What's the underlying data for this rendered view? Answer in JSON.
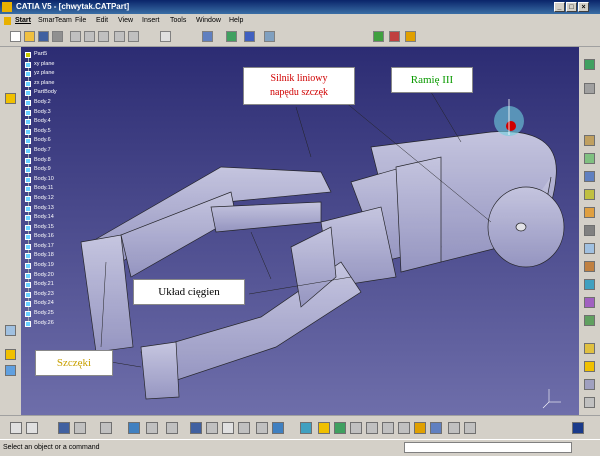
{
  "window": {
    "title": "CATIA V5 - [chwytak.CATPart]"
  },
  "menu": {
    "items": [
      "Start",
      "SmarTeam",
      "File",
      "Edit",
      "View",
      "Insert",
      "Tools",
      "Window",
      "Help"
    ]
  },
  "tree": {
    "root": "Part5",
    "nodes": [
      "xy plane",
      "yz plane",
      "zx plane",
      "PartBody",
      "Body.2",
      "Body.3",
      "Body.4",
      "Body.5",
      "Body.6",
      "Body.7",
      "Body.8",
      "Body.9",
      "Body.10",
      "Body.11",
      "Body.12",
      "Body.13",
      "Body.14",
      "Body.15",
      "Body.16",
      "Body.17",
      "Body.18",
      "Body.19",
      "Body.20",
      "Body.21",
      "Body.23",
      "Body.24",
      "Body.25",
      "Body.26"
    ]
  },
  "annotations": {
    "silnik": "Silnik liniowy\nnapędu szczęk",
    "ramie": "Ramię III",
    "uklad": "Układ cięgien",
    "szczeki": "Szczęki"
  },
  "status": {
    "text": "Select an object or a command",
    "command_placeholder": ""
  },
  "colors": {
    "title_start": "#0a246a",
    "title_end": "#3a6ea5",
    "viewport_top": "#2c2c73",
    "viewport_bottom": "#6e6eaa"
  },
  "icons": {
    "toolbar_top": [
      "new-icon",
      "open-icon",
      "save-icon",
      "print-icon",
      "cut-icon",
      "copy-icon",
      "paste-icon",
      "undo-icon",
      "redo-icon",
      "whats-this-icon",
      "sketcher-icon",
      "pad-icon",
      "grid-icon",
      "snap-icon",
      "measure-icon",
      "analysis-icon",
      "apply-material-icon"
    ],
    "toolbar_bottom": [
      "formula-icon",
      "comment-icon",
      "catalog-icon",
      "knowledge-icon",
      "publish-icon",
      "spec-icon",
      "fly-icon",
      "fit-all-icon",
      "pan-icon",
      "rotate-icon",
      "zoom-in-icon",
      "zoom-out-icon",
      "normal-view-icon",
      "iso-view-icon",
      "shading-icon",
      "hide-show-icon",
      "swap-icon",
      "compass-icon"
    ]
  }
}
